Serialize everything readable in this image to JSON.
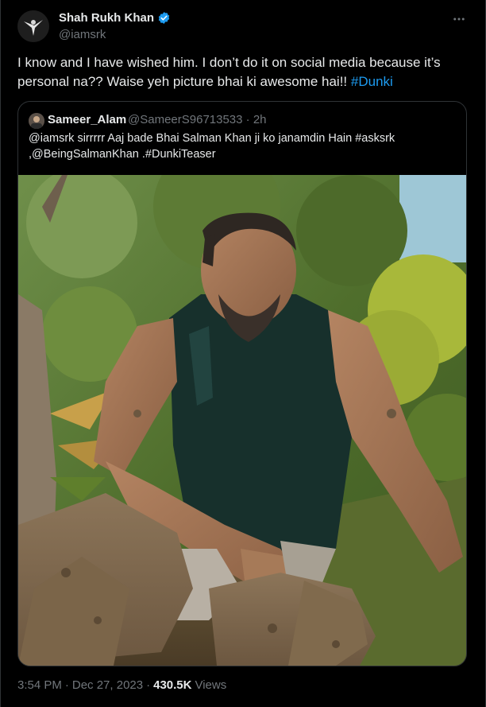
{
  "tweet": {
    "author_name": "Shah Rukh Khan",
    "author_handle": "@iamsrk",
    "text_main": "I know and I have wished him. I don’t do it on social media because it’s personal na?? Waise yeh picture bhai ki awesome hai!! ",
    "text_hashtag": "#Dunki",
    "more_icon": "more-horizontal-icon",
    "verified_icon": "verified-badge-icon",
    "verified_color": "#1d9bf0"
  },
  "quote": {
    "name": "Sameer_Alam",
    "handle_time": "@SameerS96713533 · 2h",
    "text": "@iamsrk sirrrrr Aaj bade Bhai Salman Khan ji ko janamdin Hain #asksrk ,@BeingSalmanKhan .#DunkiTeaser"
  },
  "meta": {
    "time": "3:54 PM",
    "sep": "·",
    "date": "Dec 27, 2023",
    "sep2": "·",
    "views_count": "430.5K",
    "views_label": "Views"
  },
  "colors": {
    "background": "#000000",
    "text": "#e7e9ea",
    "muted": "#71767b",
    "accent": "#1d9bf0",
    "border": "#2f3336"
  }
}
